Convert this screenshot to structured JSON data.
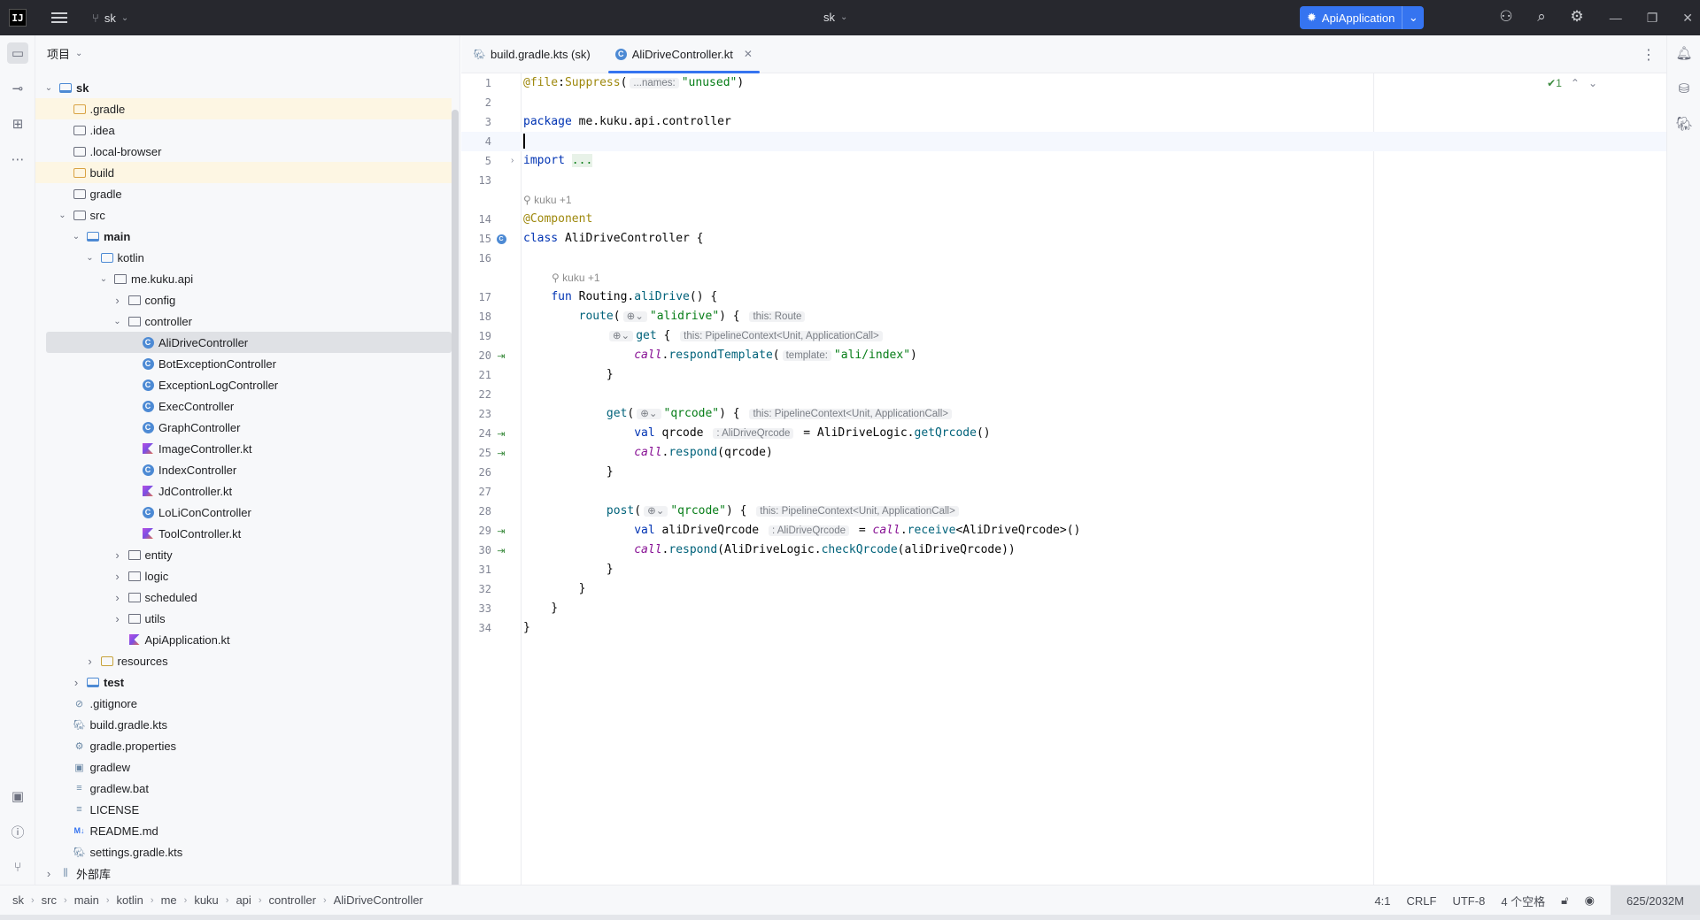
{
  "titlebar": {
    "logo": "IJ",
    "project": "sk",
    "center_title": "sk",
    "run_config": "ApiApplication"
  },
  "project_panel": {
    "title": "项目",
    "tree": [
      {
        "label": "sk",
        "depth": 0,
        "icon": "module",
        "open": true,
        "bold": true
      },
      {
        "label": ".gradle",
        "depth": 1,
        "icon": "folder-excluded",
        "hl": true
      },
      {
        "label": ".idea",
        "depth": 1,
        "icon": "folder"
      },
      {
        "label": ".local-browser",
        "depth": 1,
        "icon": "folder"
      },
      {
        "label": "build",
        "depth": 1,
        "icon": "folder-excluded",
        "hl": true
      },
      {
        "label": "gradle",
        "depth": 1,
        "icon": "folder"
      },
      {
        "label": "src",
        "depth": 1,
        "icon": "folder",
        "open": true
      },
      {
        "label": "main",
        "depth": 2,
        "icon": "module",
        "open": true,
        "bold": true
      },
      {
        "label": "kotlin",
        "depth": 3,
        "icon": "folder-src",
        "open": true
      },
      {
        "label": "me.kuku.api",
        "depth": 4,
        "icon": "package",
        "open": true
      },
      {
        "label": "config",
        "depth": 5,
        "icon": "package",
        "closed": true
      },
      {
        "label": "controller",
        "depth": 5,
        "icon": "package",
        "open": true
      },
      {
        "label": "AliDriveController",
        "depth": 6,
        "icon": "kclass",
        "sel": true
      },
      {
        "label": "BotExceptionController",
        "depth": 6,
        "icon": "kclass"
      },
      {
        "label": "ExceptionLogController",
        "depth": 6,
        "icon": "kclass"
      },
      {
        "label": "ExecController",
        "depth": 6,
        "icon": "kclass"
      },
      {
        "label": "GraphController",
        "depth": 6,
        "icon": "kclass"
      },
      {
        "label": "ImageController.kt",
        "depth": 6,
        "icon": "kfile"
      },
      {
        "label": "IndexController",
        "depth": 6,
        "icon": "kclass"
      },
      {
        "label": "JdController.kt",
        "depth": 6,
        "icon": "kfile"
      },
      {
        "label": "LoLiConController",
        "depth": 6,
        "icon": "kclass"
      },
      {
        "label": "ToolController.kt",
        "depth": 6,
        "icon": "kfile"
      },
      {
        "label": "entity",
        "depth": 5,
        "icon": "package",
        "closed": true
      },
      {
        "label": "logic",
        "depth": 5,
        "icon": "package",
        "closed": true
      },
      {
        "label": "scheduled",
        "depth": 5,
        "icon": "package",
        "closed": true
      },
      {
        "label": "utils",
        "depth": 5,
        "icon": "package",
        "closed": true
      },
      {
        "label": "ApiApplication.kt",
        "depth": 5,
        "icon": "kfile"
      },
      {
        "label": "resources",
        "depth": 3,
        "icon": "folder-res",
        "closed": true
      },
      {
        "label": "test",
        "depth": 2,
        "icon": "module",
        "closed": true,
        "bold": true
      },
      {
        "label": ".gitignore",
        "depth": 1,
        "icon": "ignore"
      },
      {
        "label": "build.gradle.kts",
        "depth": 1,
        "icon": "gradle"
      },
      {
        "label": "gradle.properties",
        "depth": 1,
        "icon": "settings"
      },
      {
        "label": "gradlew",
        "depth": 1,
        "icon": "script"
      },
      {
        "label": "gradlew.bat",
        "depth": 1,
        "icon": "text"
      },
      {
        "label": "LICENSE",
        "depth": 1,
        "icon": "text"
      },
      {
        "label": "README.md",
        "depth": 1,
        "icon": "md"
      },
      {
        "label": "settings.gradle.kts",
        "depth": 1,
        "icon": "gradle"
      },
      {
        "label": "外部库",
        "depth": 0,
        "icon": "library",
        "closed": true
      }
    ]
  },
  "tabs": [
    {
      "label": "build.gradle.kts (sk)",
      "icon": "gradle-icon",
      "active": false
    },
    {
      "label": "AliDriveController.kt",
      "icon": "kotlin-class-icon",
      "active": true
    }
  ],
  "editor": {
    "inspection_count": "1",
    "lines": [
      {
        "n": "1",
        "html": "<span class='ann'>@file</span>:<span class='ann'>Suppress</span>(<span class='hint'>...names:</span><span class='str'>\"unused\"</span>)"
      },
      {
        "n": "2",
        "html": ""
      },
      {
        "n": "3",
        "html": "<span class='kw'>package</span> me.kuku.api.controller"
      },
      {
        "n": "4",
        "html": "<span class='cursor'></span>",
        "cur": true
      },
      {
        "n": "5",
        "html": "<span class='kw'>import</span> <span class='dots'>...</span>",
        "fold": true
      },
      {
        "n": "13",
        "html": ""
      },
      {
        "author": "kuku +1"
      },
      {
        "n": "14",
        "html": "<span class='ann'>@Component</span>"
      },
      {
        "n": "15",
        "html": "<span class='kw'>class</span> AliDriveController {",
        "mark": "kclass"
      },
      {
        "n": "16",
        "html": ""
      },
      {
        "author": "kuku +1",
        "indent": 1
      },
      {
        "n": "17",
        "html": "    <span class='kw'>fun</span> Routing.<span class='fn'>aliDrive</span>() {"
      },
      {
        "n": "18",
        "html": "        <span class='fn'>route</span>(<span class='hint'>⊕⌄</span><span class='str'>\"alidrive\"</span>) { <span class='hint'>this: Route</span>"
      },
      {
        "n": "19",
        "html": "            <span class='hint'>⊕⌄</span><span class='fn'>get</span> { <span class='hint'>this: PipelineContext&lt;Unit, ApplicationCall&gt;</span>"
      },
      {
        "n": "20",
        "html": "                <span class='it'>call</span>.<span class='fn'>respondTemplate</span>(<span class='hint'>template:</span><span class='str'>\"ali/index\"</span>)",
        "mark": "suspend"
      },
      {
        "n": "21",
        "html": "            }"
      },
      {
        "n": "22",
        "html": ""
      },
      {
        "n": "23",
        "html": "            <span class='fn'>get</span>(<span class='hint'>⊕⌄</span><span class='str'>\"qrcode\"</span>) { <span class='hint'>this: PipelineContext&lt;Unit, ApplicationCall&gt;</span>"
      },
      {
        "n": "24",
        "html": "                <span class='kw'>val</span> qrcode <span class='hint'>: AliDriveQrcode</span> = AliDriveLogic.<span class='fn'>getQrcode</span>()",
        "mark": "suspend"
      },
      {
        "n": "25",
        "html": "                <span class='it'>call</span>.<span class='fn'>respond</span>(qrcode)",
        "mark": "suspend"
      },
      {
        "n": "26",
        "html": "            }"
      },
      {
        "n": "27",
        "html": ""
      },
      {
        "n": "28",
        "html": "            <span class='fn'>post</span>(<span class='hint'>⊕⌄</span><span class='str'>\"qrcode\"</span>) { <span class='hint'>this: PipelineContext&lt;Unit, ApplicationCall&gt;</span>"
      },
      {
        "n": "29",
        "html": "                <span class='kw'>val</span> aliDriveQrcode <span class='hint'>: AliDriveQrcode</span> = <span class='it'>call</span>.<span class='fn'>receive</span>&lt;AliDriveQrcode&gt;()",
        "mark": "suspend"
      },
      {
        "n": "30",
        "html": "                <span class='it'>call</span>.<span class='fn'>respond</span>(AliDriveLogic.<span class='fn'>checkQrcode</span>(aliDriveQrcode))",
        "mark": "suspend"
      },
      {
        "n": "31",
        "html": "            }"
      },
      {
        "n": "32",
        "html": "        }"
      },
      {
        "n": "33",
        "html": "    }"
      },
      {
        "n": "34",
        "html": "}"
      }
    ]
  },
  "statusbar": {
    "breadcrumb": [
      "sk",
      "src",
      "main",
      "kotlin",
      "me",
      "kuku",
      "api",
      "controller",
      "AliDriveController"
    ],
    "position": "4:1",
    "line_sep": "CRLF",
    "encoding": "UTF-8",
    "indent": "4 个空格",
    "memory": "625/2032M"
  },
  "colors": {
    "accent": "#3574f0",
    "titlebar": "#27282e"
  }
}
